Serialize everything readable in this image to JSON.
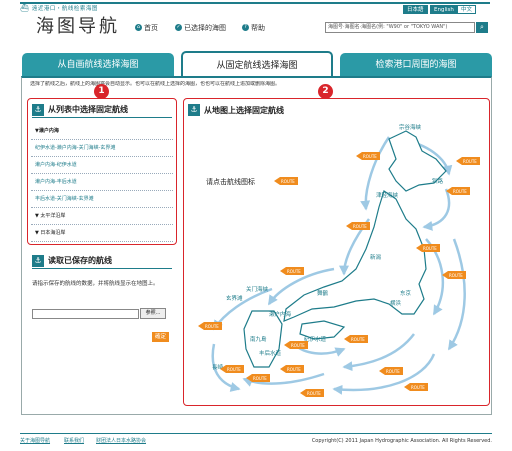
{
  "header": {
    "brand_strip": "遠近港口・航线检索海图",
    "site_title": "海图导航",
    "lang_ja": "日本語",
    "lang_en": "English",
    "lang_zh": "中文",
    "nav_home": "首页",
    "nav_favorites": "已选择的海图",
    "nav_help": "帮助",
    "search_placeholder": "海图号·海图名·海图名(例: \"W90\" or \"TOKYO WAN\")"
  },
  "tabs": [
    {
      "label": "从自画航线选择海图"
    },
    {
      "label": "从固定航线选择海图"
    },
    {
      "label": "检索港口周围的海图"
    }
  ],
  "intro": "选择了航线之后，航线上的海图将会自动显示。也可以在航线上选择的海图，也也可以在航线上追加或删除海图。",
  "badges": {
    "one": "1",
    "two": "2"
  },
  "list_panel": {
    "title": "从列表中选择固定航线",
    "items": [
      {
        "label": "▼濑户内海"
      },
      {
        "label": "纪伊水道-濑户内海-关门海峡-玄界滩"
      },
      {
        "label": "濑户内海-纪伊水道"
      },
      {
        "label": "濑户内海-丰后水道"
      },
      {
        "label": "丰后水道-关门海峡-玄界滩"
      },
      {
        "label": "▼ 太平洋沿岸"
      },
      {
        "label": "▼ 日本海沿岸"
      }
    ]
  },
  "saved_panel": {
    "title": "读取已保存的航线",
    "desc": "请指示保存的航线的数据，并将航线显示在地图上。",
    "browse_label": "参照...",
    "ok_label": "確定"
  },
  "map_panel": {
    "title": "从地图上选择固定航线",
    "hint": "请点击航线图标",
    "route_icon_label": "ROUTE",
    "places": {
      "soya": "宗谷海峡",
      "tsugaru": "津轻海峡",
      "kushiro": "钏路",
      "niigata": "新潟",
      "maizuru": "舞鶴",
      "tokyo": "东京",
      "yokohama": "横浜",
      "kanmon": "关门海峡",
      "genkai": "玄界滩",
      "seto": "濑户内海",
      "kii": "纪伊水道",
      "bungo": "丰后水道",
      "nagasaki": "長崎",
      "minami": "南九島"
    }
  },
  "footer": {
    "link_about": "关于海图导航",
    "link_contact": "联系我们",
    "link_assoc": "财团法人日本水路协会",
    "copyright": "Copyright(C) 2011 Japan Hydrographic Association. All Rights Reserved."
  },
  "colors": {
    "accent": "#1e7c8a",
    "tab": "#2b9aa6",
    "highlight": "#d9252b",
    "route": "#f08c1e",
    "sea_arrow": "#9ec9e4"
  }
}
